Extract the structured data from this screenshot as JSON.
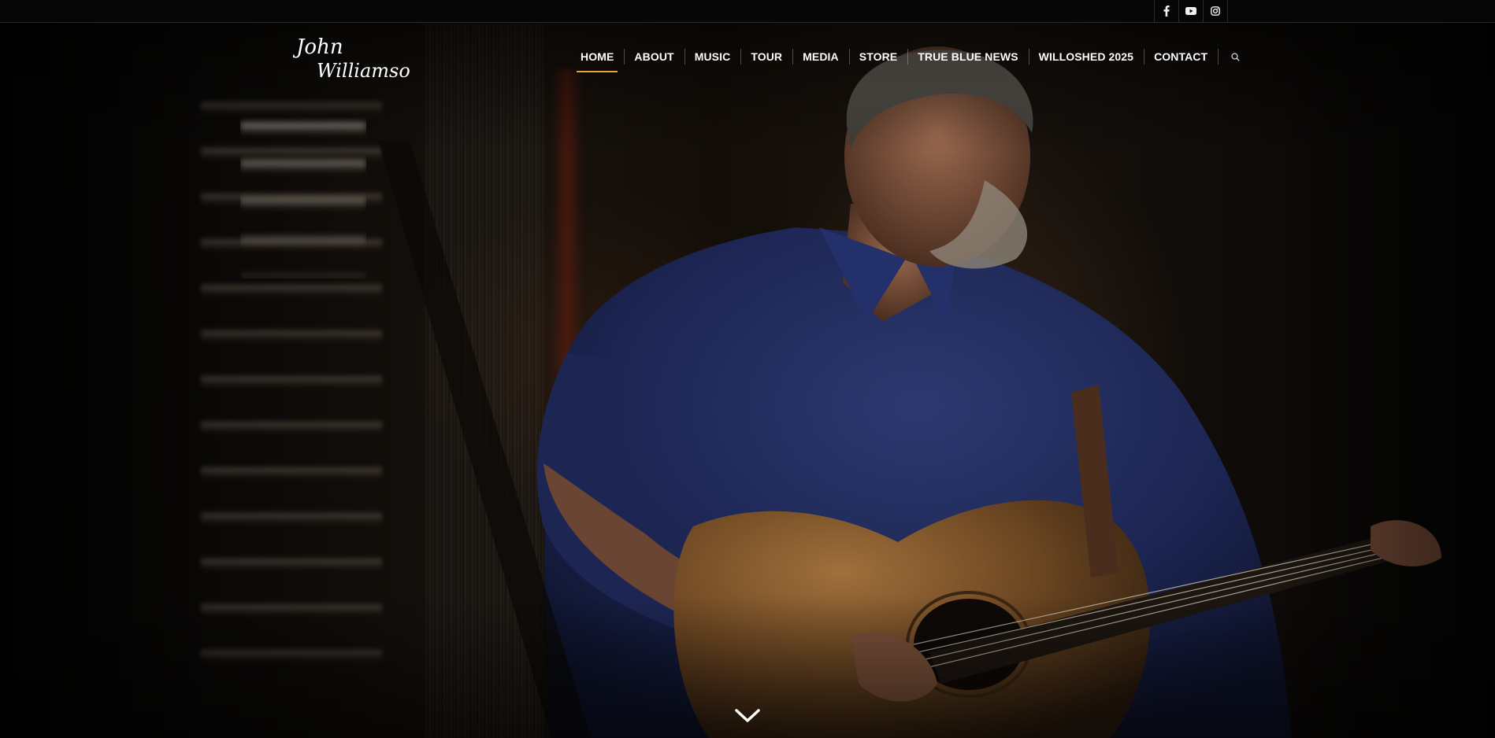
{
  "brand": {
    "logo_text": "John Williamson",
    "logo_line1": "John",
    "logo_line2": "Williamson"
  },
  "social": [
    {
      "icon": "facebook-icon",
      "label": "Facebook"
    },
    {
      "icon": "youtube-icon",
      "label": "YouTube"
    },
    {
      "icon": "instagram-icon",
      "label": "Instagram"
    }
  ],
  "nav": {
    "items": [
      {
        "label": "HOME",
        "active": true
      },
      {
        "label": "ABOUT"
      },
      {
        "label": "MUSIC"
      },
      {
        "label": "TOUR"
      },
      {
        "label": "MEDIA"
      },
      {
        "label": "STORE"
      },
      {
        "label": "TRUE BLUE NEWS"
      },
      {
        "label": "WILLOSHED 2025"
      },
      {
        "label": "CONTACT"
      }
    ],
    "search_icon": "search-icon"
  },
  "hero": {
    "image_subject": "musician playing acoustic guitar",
    "scroll_icon": "chevron-down-icon"
  },
  "colors": {
    "accent": "#e6a33a",
    "nav_text": "#ffffff",
    "topbar_bg": "#060606"
  }
}
